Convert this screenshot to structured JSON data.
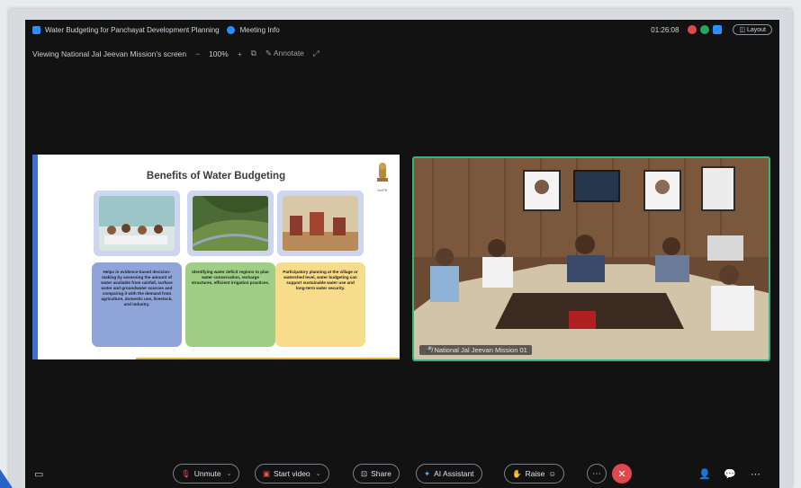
{
  "title_bar": {
    "meeting_title": "Water Budgeting for Panchayat Development Planning",
    "meeting_info": "Meeting Info",
    "timer": "01:26:08",
    "layout_label": "Layout"
  },
  "view_bar": {
    "viewing_text": "Viewing National Jal Jeevan Mission's screen",
    "zoom": "100%",
    "annotate_label": "Annotate"
  },
  "slide": {
    "title": "Benefits of Water Budgeting",
    "emblem_caption": "MoPR",
    "cards": [
      "Helps in evidence-based decision-making by assessing the amount of water available from rainfall, surface water and groundwater sources and comparing it with the demand from agriculture, domestic use, livestock, and industry.",
      "Identifying water deficit regions to plan water conservation, recharge structures, efficient irrigation practices.",
      "Participatory planning at the village or watershed level, water budgeting can support sustainable water use and long-term water security."
    ]
  },
  "video": {
    "participant_name": "National Jal Jeevan Mission 01"
  },
  "toolbar": {
    "unmute": "Unmute",
    "start_video": "Start video",
    "share": "Share",
    "ai_assistant": "AI Assistant",
    "raise": "Raise"
  },
  "colors": {
    "accent": "#2d8cff",
    "end_meeting": "#e0484f",
    "active_speaker": "#36b37e"
  }
}
